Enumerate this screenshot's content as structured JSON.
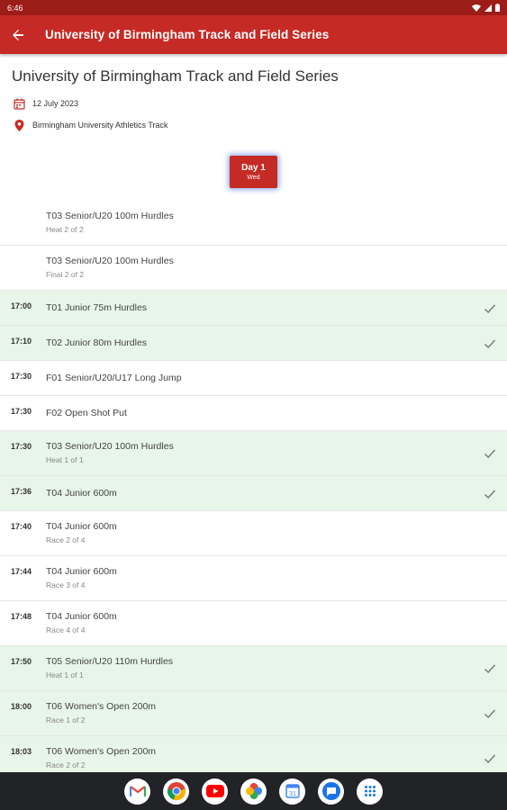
{
  "status_bar": {
    "time": "6:46"
  },
  "app_bar": {
    "title": "University of Birmingham Track and Field Series"
  },
  "event": {
    "title": "University of Birmingham Track and Field Series",
    "date": "12 July 2023",
    "location": "Birmingham University Athletics Track"
  },
  "day_tab": {
    "label": "Day 1",
    "weekday": "Wed"
  },
  "schedule": [
    {
      "time": "",
      "name": "T03 Senior/U20 100m Hurdles",
      "sub": "Heat 2 of 2",
      "done": false
    },
    {
      "time": "",
      "name": "T03 Senior/U20 100m Hurdles",
      "sub": "Final 2 of 2",
      "done": false
    },
    {
      "time": "17:00",
      "name": "T01 Junior 75m Hurdles",
      "sub": "",
      "done": true
    },
    {
      "time": "17:10",
      "name": "T02 Junior 80m Hurdles",
      "sub": "",
      "done": true
    },
    {
      "time": "17:30",
      "name": "F01 Senior/U20/U17 Long Jump",
      "sub": "",
      "done": false
    },
    {
      "time": "17:30",
      "name": "F02 Open Shot Put",
      "sub": "",
      "done": false
    },
    {
      "time": "17:30",
      "name": "T03 Senior/U20 100m Hurdles",
      "sub": "Heat 1 of 1",
      "done": true
    },
    {
      "time": "17:36",
      "name": "T04 Junior 600m",
      "sub": "",
      "done": true
    },
    {
      "time": "17:40",
      "name": "T04 Junior 600m",
      "sub": "Race 2 of 4",
      "done": false
    },
    {
      "time": "17:44",
      "name": "T04 Junior 600m",
      "sub": "Race 3 of 4",
      "done": false
    },
    {
      "time": "17:48",
      "name": "T04 Junior 600m",
      "sub": "Race 4 of 4",
      "done": false
    },
    {
      "time": "17:50",
      "name": "T05 Senior/U20 110m Hurdles",
      "sub": "Heat 1 of 1",
      "done": true
    },
    {
      "time": "18:00",
      "name": "T06 Women's Open 200m",
      "sub": "Race 1 of 2",
      "done": true
    },
    {
      "time": "18:03",
      "name": "T06 Women's Open 200m",
      "sub": "Race 2 of 2",
      "done": true
    }
  ],
  "nav_apps": [
    "gmail-icon",
    "chrome-icon",
    "youtube-icon",
    "photos-icon",
    "calendar-icon",
    "messages-icon",
    "app-drawer-icon"
  ],
  "colors": {
    "brand": "#c62a24",
    "status_bar": "#9c1c18",
    "done_row": "#e8f5e9",
    "nav_bar": "#222326"
  }
}
